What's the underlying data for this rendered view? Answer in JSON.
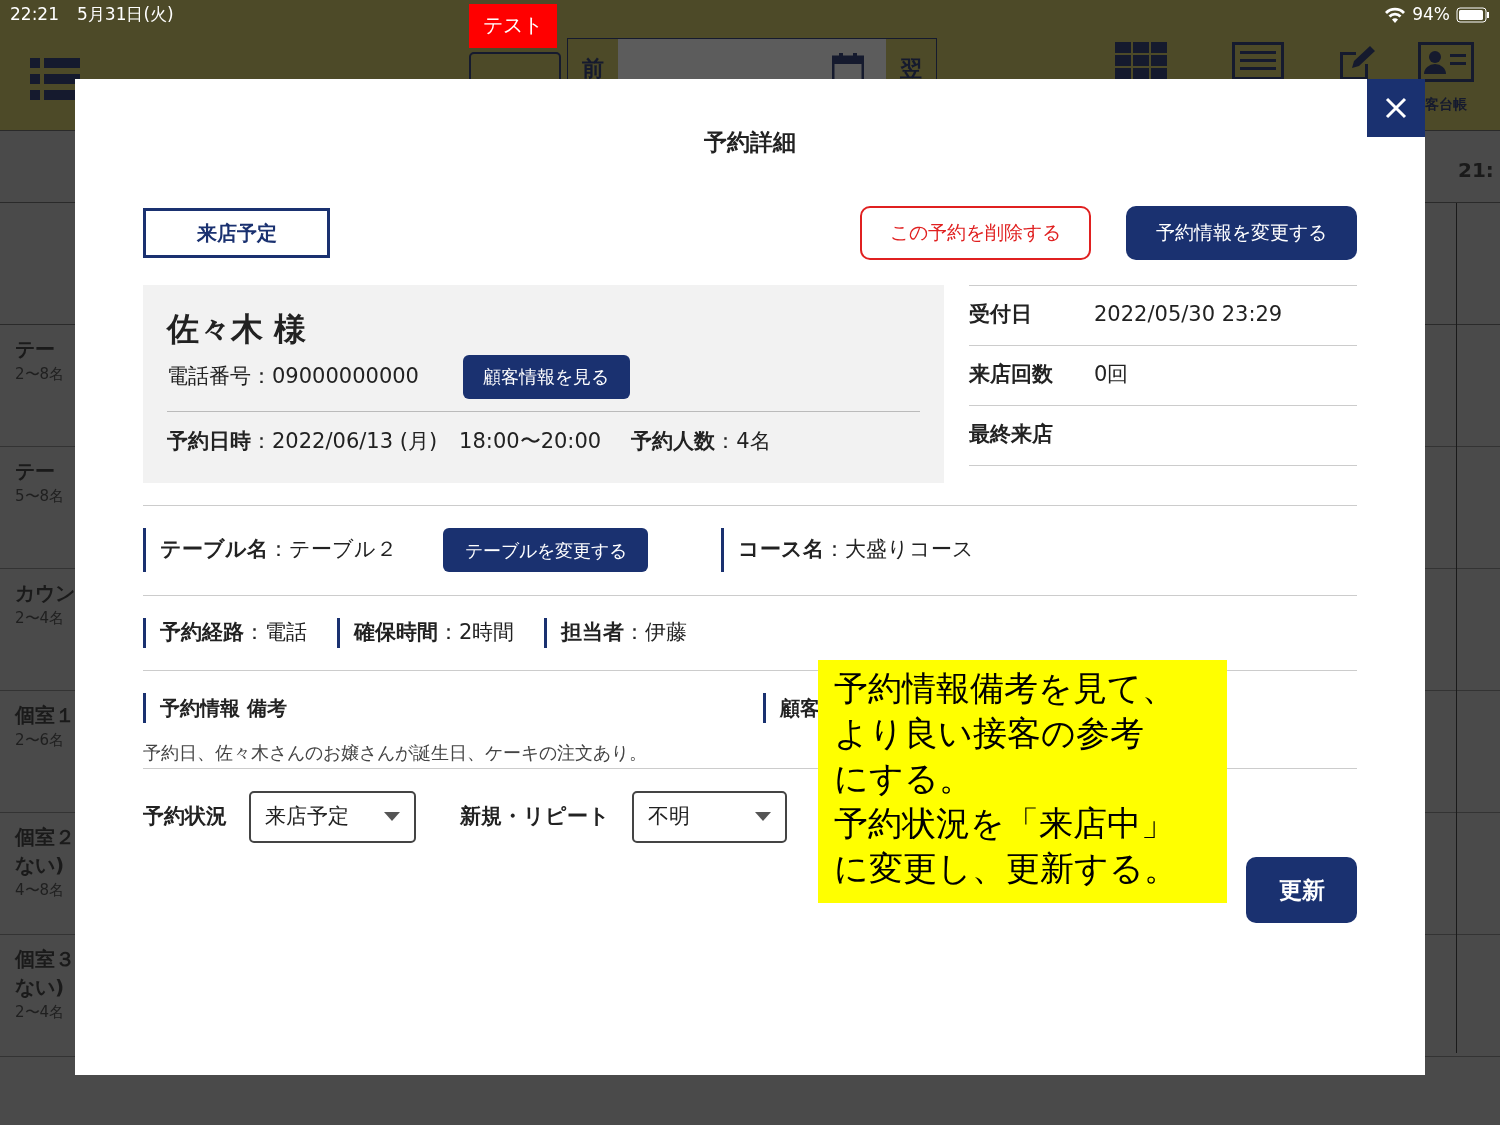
{
  "status_bar": {
    "time": "22:21",
    "date": "5月31日(火)",
    "battery": "94%"
  },
  "header": {
    "test_badge": "テスト",
    "prev": "前",
    "next": "翌",
    "customer_book": "客台帳"
  },
  "timeline": {
    "time": "21:"
  },
  "rows": [
    {
      "lines": [
        "テー"
      ],
      "capacity": "2〜8名"
    },
    {
      "lines": [
        "テー"
      ],
      "capacity": "5〜8名"
    },
    {
      "lines": [
        "カウン"
      ],
      "capacity": "2〜4名"
    },
    {
      "lines": [
        "個室１"
      ],
      "capacity": "2〜6名"
    },
    {
      "lines": [
        "個室２",
        "ない)"
      ],
      "capacity": "4〜8名"
    },
    {
      "lines": [
        "個室３",
        "ない)"
      ],
      "capacity": "2〜4名"
    }
  ],
  "modal": {
    "title": "予約詳細",
    "status_badge": "来店予定",
    "delete_button": "この予約を削除する",
    "edit_button": "予約情報を変更する",
    "customer": {
      "name": "佐々木 様",
      "phone_label": "電話番号",
      "phone_separator": "：",
      "phone": "09000000000",
      "view_button": "顧客情報を見る",
      "date_label": "予約日時",
      "date_separator": "：",
      "date": "2022/06/13 (月)",
      "time": "18:00〜20:00",
      "party_label": "予約人数",
      "party_separator": "：",
      "party": "4名"
    },
    "info": [
      {
        "label": "受付日",
        "value": "2022/05/30 23:29"
      },
      {
        "label": "来店回数",
        "value": "0回"
      },
      {
        "label": "最終来店"
      }
    ],
    "table": {
      "label": "テーブル名",
      "separator": "：",
      "value": "テーブル２",
      "button": "テーブルを変更する",
      "course_label": "コース名",
      "course_separator": "：",
      "course": "大盛りコース"
    },
    "details": [
      {
        "label": "予約経路",
        "separator": "：",
        "value": "電話"
      },
      {
        "label": "確保時間",
        "separator": "：",
        "value": "2時間"
      },
      {
        "label": "担当者",
        "separator": "：",
        "value": "伊藤"
      }
    ],
    "notes": {
      "label": "予約情報 備考",
      "text": "予約日、佐々木さんのお嬢さんが誕生日、ケーキの注文あり。",
      "customer_label": "顧客"
    },
    "selects": [
      {
        "label": "予約状況",
        "value": "来店予定"
      },
      {
        "label": "新規・リピート",
        "value": "不明"
      }
    ],
    "update_button": "更新"
  },
  "annotation": [
    "予約情報備考を見て、",
    "より良い接客の参考",
    "にする。",
    "予約状況を「来店中」",
    "に変更し、更新する。"
  ]
}
